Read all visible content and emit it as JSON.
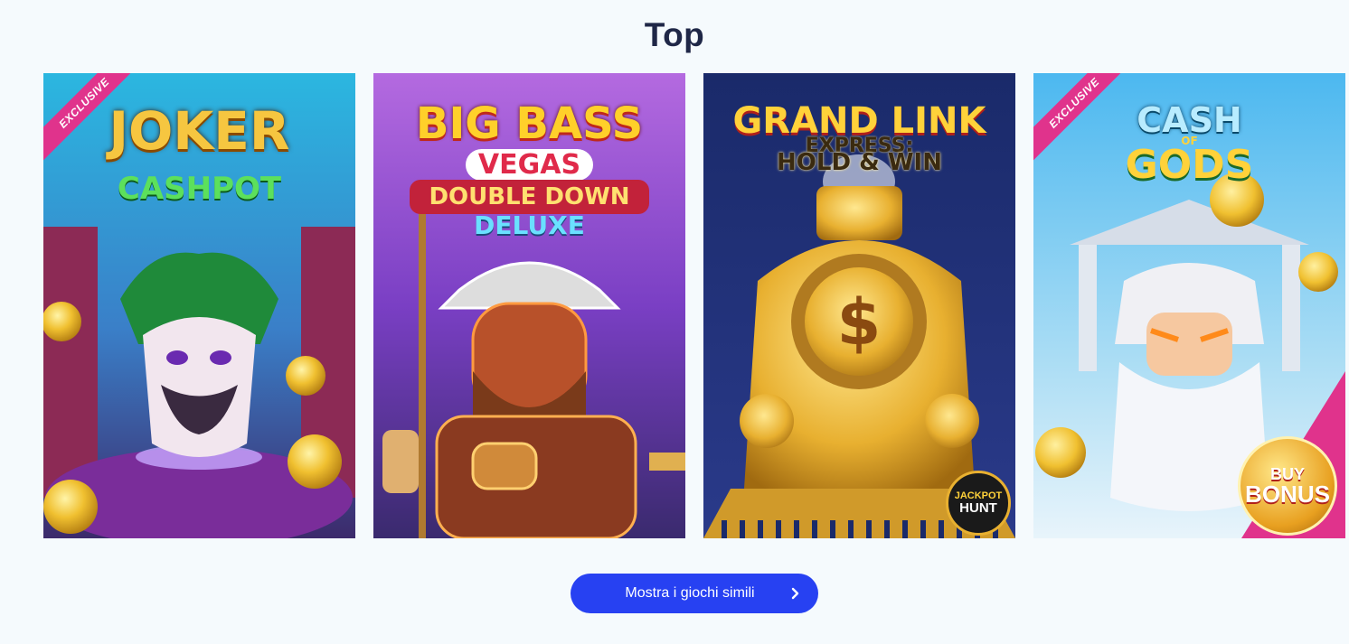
{
  "section": {
    "title": "Top"
  },
  "games": [
    {
      "name": "Joker Cashpot",
      "badge": "EXCLUSIVE",
      "logo_line1": "JOKER",
      "logo_line2": "CASHPOT"
    },
    {
      "name": "Big Bass Vegas Double Down Deluxe",
      "logo_line1": "BIG BASS",
      "logo_line2": "VEGAS",
      "logo_line3": "DOUBLE DOWN",
      "logo_line4": "DELUXE"
    },
    {
      "name": "Grand Link Express: Hold & Win",
      "logo_line1": "GRAND LINK",
      "logo_line2": "EXPRESS:",
      "logo_line3": "HOLD & WIN",
      "corner_badge_line1": "JACKPOT",
      "corner_badge_line2": "HUNT"
    },
    {
      "name": "Cash of Gods",
      "badge": "EXCLUSIVE",
      "logo_line1": "CASH",
      "logo_line2": "OF",
      "logo_line3": "GODS",
      "corner_badge_line1": "BUY",
      "corner_badge_line2": "BONUS"
    }
  ],
  "cta": {
    "label": "Mostra i giochi simili",
    "icon": "chevron-right-icon"
  },
  "colors": {
    "background": "#f5fafd",
    "title": "#1f2747",
    "cta": "#2741f2",
    "ribbon": "#e0338c"
  }
}
